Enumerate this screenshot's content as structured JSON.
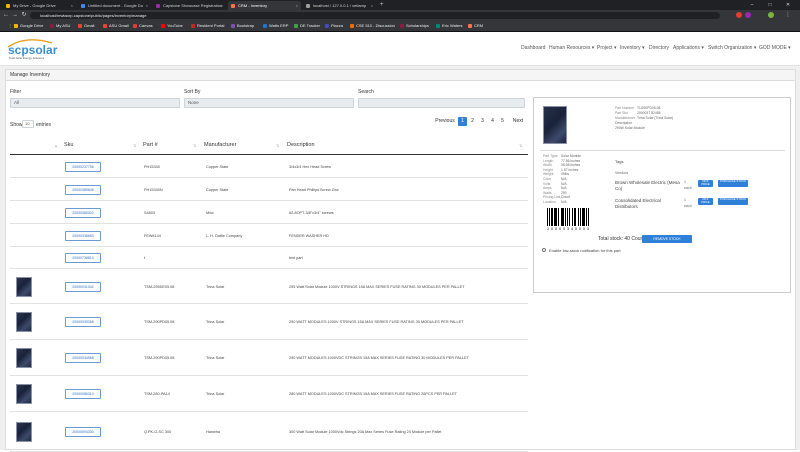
{
  "browser": {
    "tabs": [
      {
        "title": "My Drive - Google Drive",
        "color": "#f4b400"
      },
      {
        "title": "Untitled document - Google Do",
        "color": "#4285f4"
      },
      {
        "title": "Capstone Showcase Registration",
        "color": "#9c27b0"
      },
      {
        "title": "CRM - Inventory",
        "color": "#ff7043",
        "active": true
      },
      {
        "title": "localhost / 127.0.0.1 / xetlamp",
        "color": "#9e9e9e"
      }
    ],
    "url": "localhost/rewtaorp-capstone/public/pages/inventory/manage",
    "bookmarks": [
      {
        "label": "Google Drive",
        "color": "#f4b400"
      },
      {
        "label": "My ASU",
        "color": "#8c1d40"
      },
      {
        "label": "Gmail",
        "color": "#ea4335"
      },
      {
        "label": "ASU Gmail",
        "color": "#ea4335"
      },
      {
        "label": "Canvas",
        "color": "#e53935"
      },
      {
        "label": "YouTube",
        "color": "#ff0000"
      },
      {
        "label": "Resident Portal",
        "color": "#c62828"
      },
      {
        "label": "Bootstrap",
        "color": "#7952b3"
      },
      {
        "label": "Watts ERP",
        "color": "#1976d2"
      },
      {
        "label": "DE Tracker",
        "color": "#43a047"
      },
      {
        "label": "Piazza",
        "color": "#3f51b5"
      },
      {
        "label": "CSE 510 - Discussion",
        "color": "#ef6c00"
      },
      {
        "label": "Scholarships",
        "color": "#8c1d40"
      },
      {
        "label": "Eric Waters",
        "color": "#00897b"
      },
      {
        "label": "CRM",
        "color": "#ff7043"
      }
    ]
  },
  "app": {
    "logo_text": "scpsolar",
    "logo_tagline": "Total Solar Energy Solutions",
    "nav": [
      "Dashboard",
      "Human Resources ▾",
      "Project ▾",
      "Inventory ▾",
      "Directory",
      "Applications ▾",
      "Switch Organization ▾",
      "GOD MODE ▾"
    ]
  },
  "page": {
    "heading": "Manage Inventory",
    "filter_label": "Filter",
    "filter_value": "All",
    "sort_label": "Sort By",
    "sort_value": "None",
    "search_label": "Search",
    "search_value": "",
    "show_label": "Show",
    "show_value": "10",
    "entries_label": "entries",
    "pagination": [
      "Previous",
      "1",
      "2",
      "3",
      "4",
      "5",
      "Next"
    ],
    "columns": [
      "Sku",
      "Part #",
      "Manufacturer",
      "Description"
    ],
    "rows": [
      {
        "sku": "20000237756",
        "part": "PH15340",
        "mfr": "Copper State",
        "desc": "3/4x3/4 Hex Head Screw",
        "img": false
      },
      {
        "sku": "20000389846",
        "part": "PH15340N",
        "mfr": "Copper State",
        "desc": "Pan Head Phillips Screw Zinc",
        "img": false
      },
      {
        "sku": "20000380302",
        "part": "S4803",
        "mfr": "Misc",
        "desc": "#2-8OPT-3/8\"x3/4\" screws",
        "img": false
      },
      {
        "sku": "20000336653",
        "part": "FEW#144",
        "mfr": "L. H. Dottie Company",
        "desc": "FENDER WASHER HD",
        "img": false
      },
      {
        "sku": "20000738813",
        "part": "t",
        "mfr": "",
        "desc": "test part",
        "img": false
      },
      {
        "sku": "20000031042",
        "part": "TSM-295DE05.08",
        "mfr": "Trina Solar",
        "desc": "295 Watt Solar Module 1000V STRINGS 15A MAX SERIES FUSE RATING 30 MODULES PER PALLET",
        "img": true
      },
      {
        "sku": "20000033368",
        "part": "TSM-290PD05.08",
        "mfr": "Trina Solar",
        "desc": "290 WATT MODULES 1000V STRINGS 15A MAX SERIES FUSE RATING 30 MODULES PER PALLET",
        "img": true
      },
      {
        "sku": "20000034558",
        "part": "TSM-290PD05.08",
        "mfr": "Trina Solar",
        "desc": "290 WATT MODULES 1000VDC STRINGS 15A MAX SERIES FUSE RATING 30 MODULES PER PALLET",
        "img": true
      },
      {
        "sku": "20000086314",
        "part": "TSM-280-PA14",
        "mfr": "Trina Solar",
        "desc": "280 WATT MODULES 1000VDC STRINGS 15A MAX SERIES FUSE RATING 26PCS PER PALLET",
        "img": true
      },
      {
        "sku": "20000094330",
        "part": "Q.PK-G-SC 300",
        "mfr": "Hanwha",
        "desc": "300 Watt Solar Module 1000Vdc Strings 20A Max Series Fuse Rating 24 Module per Pallet",
        "img": true
      }
    ],
    "detail": {
      "top": [
        {
          "k": "Part Number",
          "v": "TU290PD05.08"
        },
        {
          "k": "Part Sku",
          "v": "2000037 82468"
        },
        {
          "k": "Manufacturer",
          "v": "Trina Solar (Trina Solar)"
        },
        {
          "k": "Description",
          "v": ""
        },
        {
          "k": "290W Solar Module",
          "v": ""
        }
      ],
      "specs": [
        {
          "k": "Part Type",
          "v": "Solar Module"
        },
        {
          "k": "Length",
          "v": "77.56 inches"
        },
        {
          "k": "Width",
          "v": "38.98 inches"
        },
        {
          "k": "Height",
          "v": "1.57 inches"
        },
        {
          "k": "Weight",
          "v": "49lbs"
        },
        {
          "k": "Color",
          "v": "N/A"
        },
        {
          "k": "Volts",
          "v": "N/A"
        },
        {
          "k": "Amps",
          "v": "N/A"
        },
        {
          "k": "Watts",
          "v": "290"
        },
        {
          "k": "Pricing Unit",
          "v": "Count"
        },
        {
          "k": "Location",
          "v": "N/A"
        }
      ],
      "tags_label": "Tags",
      "vendors_label": "Vendors",
      "vendors": [
        {
          "name": "Brown Wholesale Electric (Mesa Co)",
          "qty": "1",
          "unit": "each",
          "b1": "DIFF PRICE",
          "b2": "PURCHASE STOCK"
        },
        {
          "name": "Consolidated Electrical Distributors",
          "qty": "1",
          "unit": "each",
          "b1": "DIFF PRICE",
          "b2": "PURCHASE STOCK"
        }
      ],
      "barcode_text": "1 0 0 0 0 3 4 0 0 0 3",
      "total_stock": "Total stock: 40 Count",
      "remove_stock": "REMOVE STOCK",
      "low_stock_label": "Enable low-stock notification for this part"
    }
  }
}
